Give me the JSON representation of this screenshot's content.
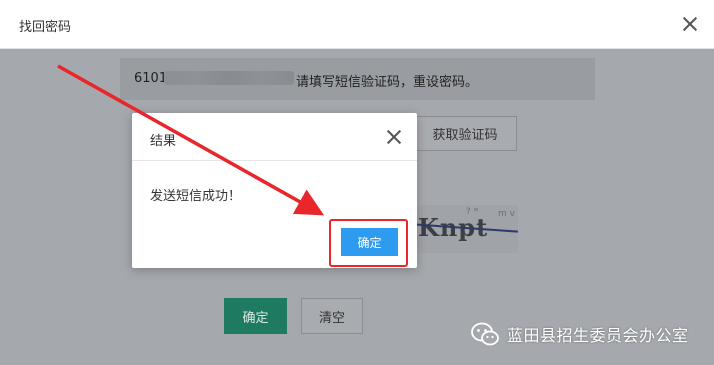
{
  "dialog": {
    "title": "找回密码"
  },
  "notice": {
    "phone_prefix": "6101",
    "message": "请填写短信验证码，重设密码。"
  },
  "form": {
    "get_code_label": "获取验证码",
    "captcha_text": "Knpt",
    "confirm_label": "确定",
    "clear_label": "清空"
  },
  "popup": {
    "title": "结果",
    "message": "发送短信成功！",
    "ok_label": "确定"
  },
  "watermark": {
    "text": "蓝田县招生委员会办公室",
    "icon": "wechat-icon"
  },
  "annotation": {
    "arrow_color": "#e8262b",
    "box_color": "#e8262b"
  },
  "colors": {
    "primary_green": "#1e7b62",
    "popup_button_blue": "#2d9cf0",
    "overlay_gray": "#a5a8ad"
  }
}
